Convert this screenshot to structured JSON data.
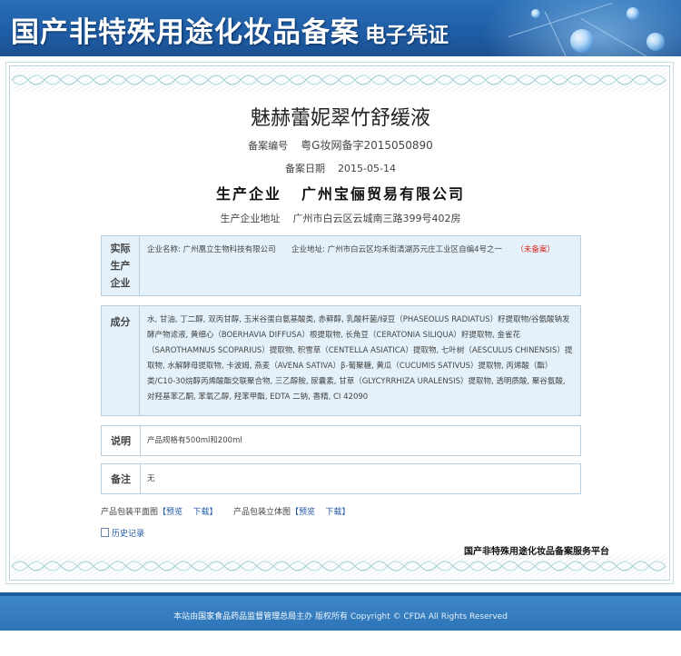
{
  "header": {
    "title": "国产非特殊用途化妆品备案",
    "subtitle": "电子凭证"
  },
  "product": {
    "name": "魅赫蕾妮翠竹舒缓液",
    "reg_no_label": "备案编号",
    "reg_no": "粤G妆网备字2015050890",
    "reg_date_label": "备案日期",
    "reg_date": "2015-05-14",
    "company_label": "生产企业",
    "company_name": "广州宝俪贸易有限公司",
    "addr_label": "生产企业地址",
    "addr": "广州市白云区云城南三路399号402房"
  },
  "actual_producer": {
    "label": "实际生产企业",
    "name_label": "企业名称:",
    "name": "广州凰立生物科技有限公司",
    "addr_label": "企业地址:",
    "addr": "广州市白云区均禾街清湖苏元庄工业区自编4号之一",
    "status": "（未备案）"
  },
  "ingredients": {
    "label": "成分",
    "text": "水, 甘油, 丁二醇, 双丙甘醇, 玉米谷蛋白氨基酸类, 赤藓醇, 乳酸杆菌/绿豆（PHASEOLUS RADIATUS）籽提取物/谷氨酸钠发酵产物滤液, 黄细心（BOERHAVIA DIFFUSA）根提取物, 长角豆（CERATONIA SILIQUA）籽提取物, 金雀花（SAROTHAMNUS SCOPARIUS）提取物, 积雪草（CENTELLA ASIATICA）提取物, 七叶树（AESCULUS CHINENSIS）提取物, 水解酵母提取物, 卡波姆, 燕麦（AVENA SATIVA）β-葡聚糖, 黄瓜（CUCUMIS SATIVUS）提取物, 丙烯酸（酯）类/C10-30烷醇丙烯酸酯交联聚合物, 三乙醇胺, 尿囊素, 甘草（GLYCYRRHIZA URALENSIS）提取物, 透明质酸, 聚谷氨酸, 对羟基苯乙酮, 苯氧乙醇, 羟苯甲酯, EDTA 二钠, 香精, CI 42090"
  },
  "description": {
    "label": "说明",
    "text": "产品规格有500ml和200ml"
  },
  "remarks": {
    "label": "备注",
    "text": "无"
  },
  "package": {
    "flat_label": "产品包装平面图",
    "solid_label": "产品包装立体图",
    "preview": "预览",
    "download": "下载",
    "bracket_open": "【",
    "bracket_close": "】"
  },
  "history_link": "历史记录",
  "platform": "国产非特殊用途化妆品备案服务平台",
  "footer": {
    "prefix": "本站由",
    "org": "国家食品药品监督管理总局",
    "suffix": "主办 版权所有 Copyright © CFDA All Rights Reserved"
  }
}
